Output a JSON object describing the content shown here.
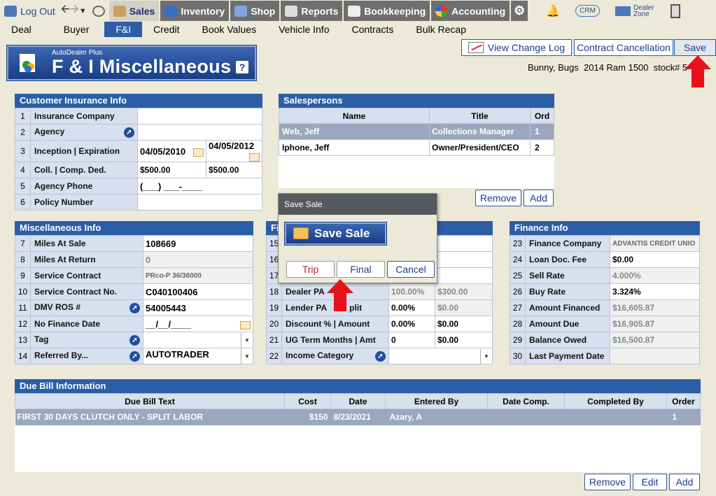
{
  "top_nav": {
    "logout": "Log Out",
    "sales": "Sales",
    "inventory": "Inventory",
    "shop": "Shop",
    "reports": "Reports",
    "bookkeeping": "Bookkeeping",
    "accounting": "Accounting",
    "crm": "CRM",
    "dealer_zone_1": "Dealer",
    "dealer_zone_2": "Zone"
  },
  "sub_nav": [
    "Deal",
    "Buyer",
    "F&I",
    "Credit",
    "Book Values",
    "Vehicle Info",
    "Contracts",
    "Bulk Recap"
  ],
  "logo": {
    "line1": "AutoDealer Plus",
    "line2": "F & I Miscellaneous",
    "help": "?"
  },
  "buttons": {
    "change_log": "View Change Log",
    "cancellation": "Contract Cancellation",
    "save": "Save"
  },
  "deal_info": {
    "name": "Bunny,  Bugs",
    "vehicle": "2014 Ram 1500",
    "stock": "stock# 5"
  },
  "customer_insurance": {
    "title": "Customer Insurance Info",
    "rows": [
      {
        "n": "1",
        "label": "Insurance Company",
        "v": ""
      },
      {
        "n": "2",
        "label": "Agency",
        "v": ""
      },
      {
        "n": "3",
        "label": "Inception | Expiration",
        "v": "04/05/2010",
        "v2": "04/05/2012"
      },
      {
        "n": "4",
        "label": "Coll. | Comp. Ded.",
        "v": "$500.00",
        "v2": "$500.00"
      },
      {
        "n": "5",
        "label": "Agency Phone",
        "v": "(___) ___-____"
      },
      {
        "n": "6",
        "label": "Policy Number",
        "v": ""
      }
    ]
  },
  "salespersons": {
    "title": "Salespersons",
    "headers": [
      "Name",
      "Title",
      "Ord"
    ],
    "rows": [
      [
        "Web, Jeff",
        "Collections Manager",
        "1"
      ],
      [
        "Iphone, Jeff",
        "Owner/President/CEO",
        "2"
      ]
    ],
    "remove": "Remove",
    "add": "Add"
  },
  "misc": {
    "title": "Miscellaneous Info",
    "rows": [
      {
        "n": "7",
        "label": "Miles At Sale",
        "v": "108669"
      },
      {
        "n": "8",
        "label": "Miles At Return",
        "v": "0"
      },
      {
        "n": "9",
        "label": "Service Contract",
        "v": "PRco-P 36/36000"
      },
      {
        "n": "10",
        "label": "Service Contract No.",
        "v": "C040100406"
      },
      {
        "n": "11",
        "label": "DMV ROS #",
        "v": "54005443"
      },
      {
        "n": "12",
        "label": "No Finance Date",
        "v": "__/__/____"
      },
      {
        "n": "13",
        "label": "Tag",
        "v": ""
      },
      {
        "n": "14",
        "label": "Referred By...",
        "v": "AUTOTRADER"
      }
    ]
  },
  "mid": {
    "title": "Fi",
    "rows": [
      {
        "n": "15",
        "label": "",
        "a": "",
        "b": ""
      },
      {
        "n": "16",
        "label": "",
        "a": "",
        "b": ""
      },
      {
        "n": "17",
        "label": "",
        "a": "",
        "b": ""
      },
      {
        "n": "18",
        "label": "Dealer PA",
        "a": "100.00%",
        "b": "$300.00"
      },
      {
        "n": "19",
        "label": "Lender PA",
        "label_tail": "plit",
        "a": "0.00%",
        "b": "$0.00"
      },
      {
        "n": "20",
        "label": "Discount % | Amount",
        "a": "0.00%",
        "b": "$0.00"
      },
      {
        "n": "21",
        "label": "UG Term Months | Amt",
        "a": "0",
        "b": "$0.00"
      },
      {
        "n": "22",
        "label": "Income Category",
        "a": "",
        "b": ""
      }
    ]
  },
  "finance": {
    "title": "Finance Info",
    "rows": [
      {
        "n": "23",
        "label": "Finance Company",
        "v": "ADVANTIS CREDIT UNIO"
      },
      {
        "n": "24",
        "label": "Loan Doc. Fee",
        "v": "$0.00"
      },
      {
        "n": "25",
        "label": "Sell Rate",
        "v": "4.000%"
      },
      {
        "n": "26",
        "label": "Buy Rate",
        "v": "3.324%"
      },
      {
        "n": "27",
        "label": "Amount Financed",
        "v": "$16,605.87"
      },
      {
        "n": "28",
        "label": "Amount Due",
        "v": "$16,905.87"
      },
      {
        "n": "29",
        "label": "Balance Owed",
        "v": "$16,500.87"
      },
      {
        "n": "30",
        "label": "Last Payment Date",
        "v": ""
      }
    ]
  },
  "due_bill": {
    "title": "Due Bill Information",
    "headers": [
      "Due Bill Text",
      "Cost",
      "Date",
      "Entered By",
      "Date Comp.",
      "Completed By",
      "Order"
    ],
    "rows": [
      [
        "FIRST 30 DAYS CLUTCH ONLY - SPLIT LABOR",
        "$150",
        "8/23/2021",
        "Azary, A",
        "",
        "",
        "1"
      ]
    ],
    "remove": "Remove",
    "edit": "Edit",
    "add": "Add"
  },
  "dialog": {
    "title": "Save Sale",
    "main": "Save Sale",
    "trip": "Trip",
    "final": "Final",
    "cancel": "Cancel"
  },
  "colors": {
    "header_blue": "#2b5ea6",
    "label_bg": "#d6e0ee",
    "arrow_red": "#e8101a"
  }
}
